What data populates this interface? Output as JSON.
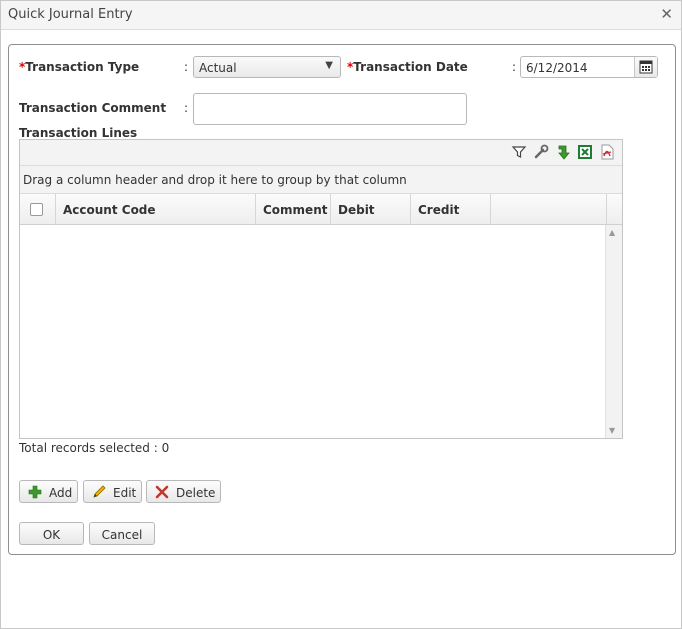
{
  "window": {
    "title": "Quick Journal Entry"
  },
  "form": {
    "required_mark": "*",
    "colon": ":",
    "transaction_type_label": "Transaction Type",
    "transaction_type_value": "Actual",
    "transaction_date_label": "Transaction Date",
    "transaction_date_value": "6/12/2014",
    "transaction_comment_label": "Transaction Comment",
    "transaction_comment_value": "",
    "transaction_lines_label": "Transaction Lines"
  },
  "grid": {
    "toolbar_icons": [
      "filter-icon",
      "wrench-icon",
      "refresh-icon",
      "excel-export-icon",
      "pdf-export-icon"
    ],
    "group_hint": "Drag a column header and drop it here to group by that column",
    "columns": [
      "Account Code",
      "Comment",
      "Debit",
      "Credit"
    ],
    "rows": [],
    "total_records": "Total records selected : 0"
  },
  "actions": {
    "add": "Add",
    "edit": "Edit",
    "delete": "Delete"
  },
  "footer": {
    "ok": "OK",
    "cancel": "Cancel"
  },
  "colors": {
    "required": "#dd0000",
    "add_icon": "#3a9a2a",
    "delete_icon": "#c0392b",
    "excel_icon": "#1e7b34",
    "pdf_icon": "#d32f2f"
  }
}
